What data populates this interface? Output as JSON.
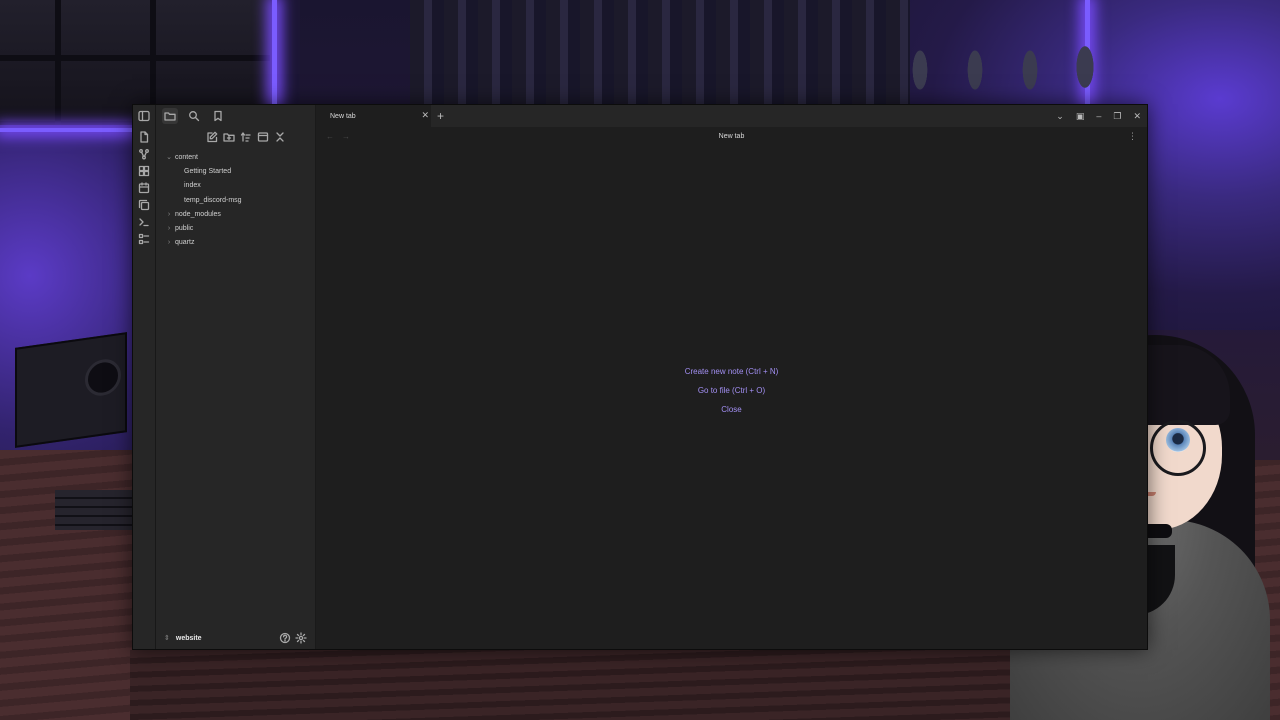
{
  "colors": {
    "accent": "#a28ff2",
    "window_bg": "#1e1e1e",
    "sidebar_bg": "#262626"
  },
  "ribbon": {
    "toggle_icon": "sidebar-toggle-icon",
    "items": [
      "open-quick-switcher-icon",
      "graph-view-icon",
      "canvas-icon",
      "daily-note-icon",
      "templates-icon",
      "command-palette-icon",
      "bases-icon"
    ]
  },
  "sidebar": {
    "header_icons": [
      "files-icon",
      "search-icon",
      "bookmark-icon"
    ],
    "action_icons": [
      "new-note-icon",
      "new-folder-icon",
      "sort-icon",
      "collapse-icon",
      "close-all-icon"
    ],
    "tree": [
      {
        "label": "content",
        "expanded": true,
        "children": [
          "Getting Started",
          "index",
          "temp_discord-msg"
        ]
      },
      {
        "label": "node_modules",
        "expanded": false
      },
      {
        "label": "public",
        "expanded": false
      },
      {
        "label": "quartz",
        "expanded": false
      }
    ],
    "vault_name": "website"
  },
  "tabs": [
    {
      "label": "New tab"
    }
  ],
  "view": {
    "title": "New tab",
    "actions": {
      "create": "Create new note (Ctrl + N)",
      "goto": "Go to file (Ctrl + O)",
      "close": "Close"
    }
  }
}
